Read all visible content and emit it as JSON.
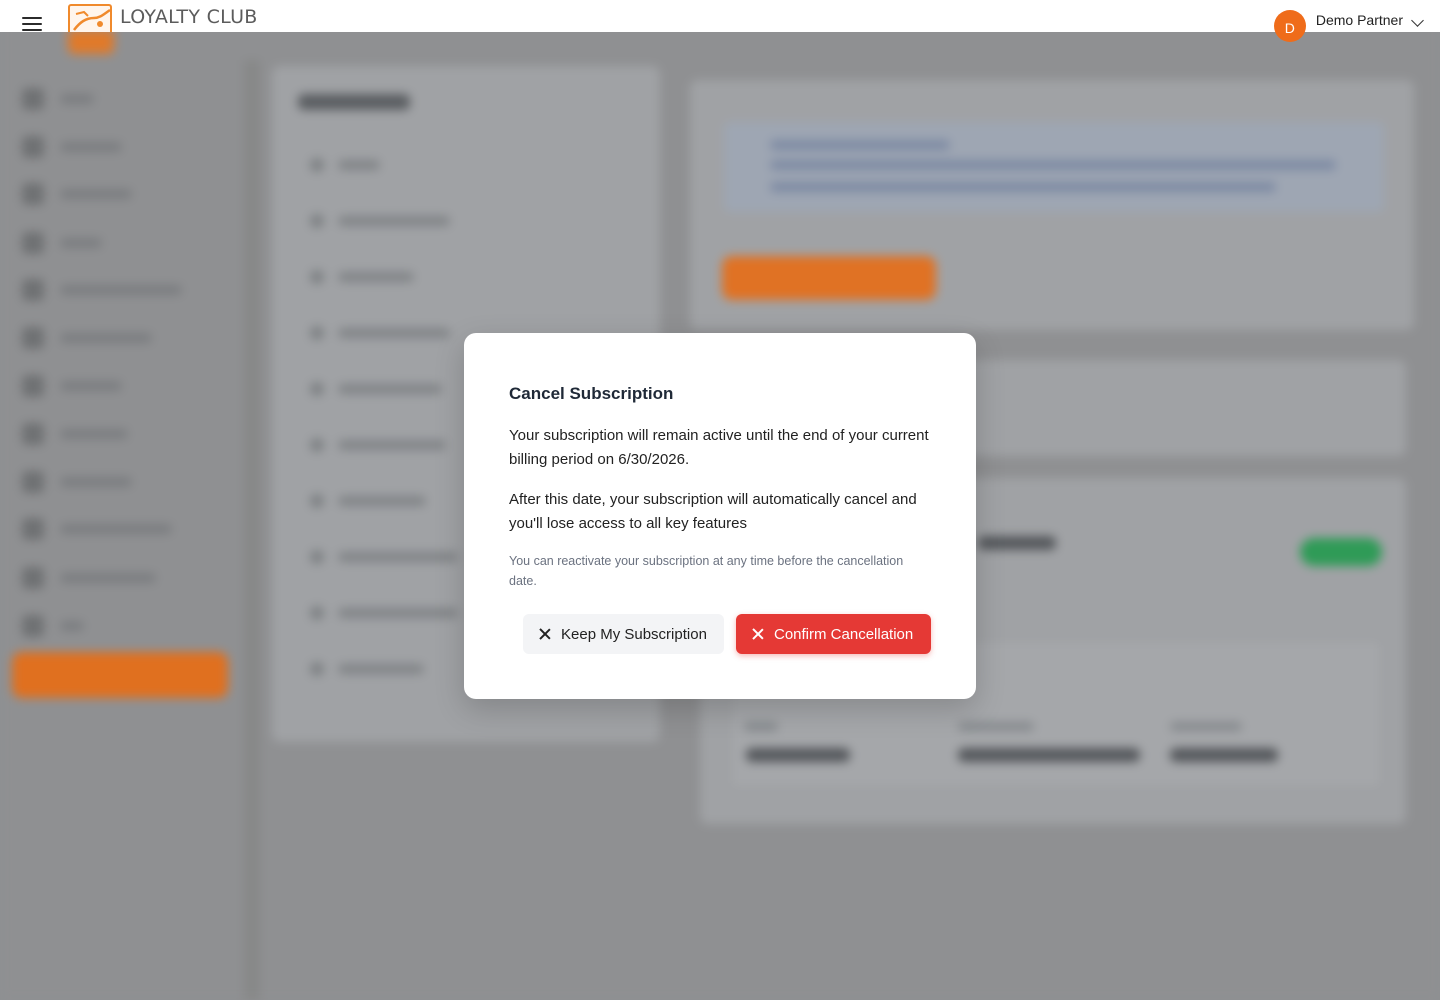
{
  "header": {
    "brand": "LOYALTY CLUB",
    "user_initial": "D",
    "user_name": "Demo Partner"
  },
  "modal": {
    "title": "Cancel Subscription",
    "paragraph_1": "Your subscription will remain active until the end of your current billing period on 6/30/2026.",
    "paragraph_2": "After this date, your subscription will automatically cancel and you'll lose access to all key features",
    "note": "You can reactivate your subscription at any time before the cancellation date.",
    "keep_label": "Keep My Subscription",
    "confirm_label": "Confirm Cancellation"
  },
  "colors": {
    "brand_orange": "#ef6c1a",
    "danger": "#e53935",
    "overlay": "#8f9092"
  }
}
